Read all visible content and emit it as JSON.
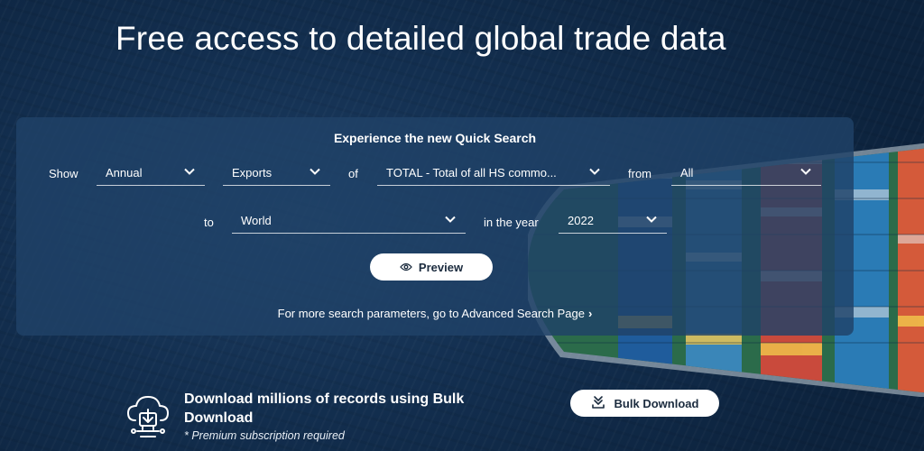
{
  "hero": {
    "title": "Free access to detailed global trade data"
  },
  "quick_search": {
    "title": "Experience the new Quick Search",
    "show_label": "Show",
    "frequency": "Annual",
    "flow": "Exports",
    "of_label": "of",
    "commodity": "TOTAL - Total of all HS commo...",
    "from_label": "from",
    "reporter": "All",
    "to_label": "to",
    "partner": "World",
    "year_label": "in the year",
    "year": "2022",
    "preview_label": "Preview",
    "advanced_link": "For more search parameters, go to Advanced Search Page"
  },
  "bulk": {
    "title": "Download millions of records using Bulk Download",
    "note": "* Premium subscription required",
    "button_label": "Bulk Download"
  },
  "icons": [
    "chevron-down-icon",
    "eye-icon",
    "chevron-right-icon",
    "cloud-download-icon",
    "download-tray-icon"
  ]
}
